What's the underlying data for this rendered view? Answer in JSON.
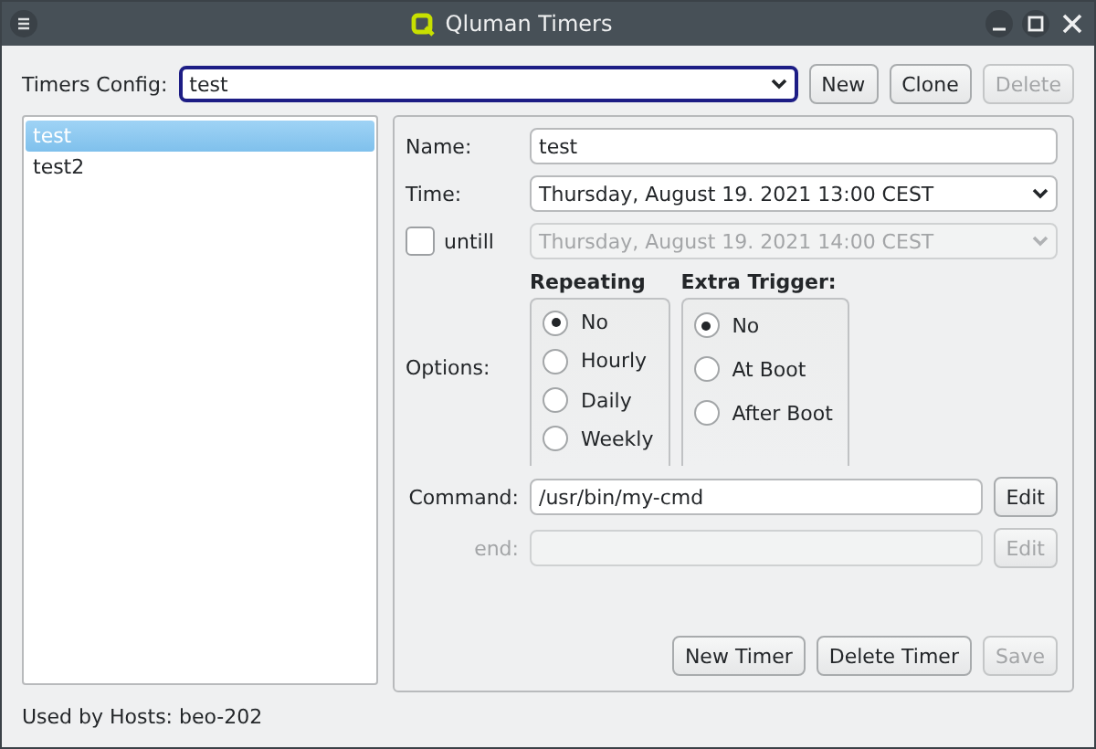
{
  "window": {
    "title": "Qluman Timers"
  },
  "config": {
    "label": "Timers Config:",
    "value": "test"
  },
  "config_buttons": [
    {
      "label": "New",
      "disabled": false
    },
    {
      "label": "Clone",
      "disabled": false
    },
    {
      "label": "Delete",
      "disabled": true
    }
  ],
  "timers": [
    {
      "label": "test",
      "selected": true
    },
    {
      "label": "test2",
      "selected": false
    }
  ],
  "form": {
    "name": {
      "label": "Name:",
      "value": "test"
    },
    "time": {
      "label": "Time:",
      "value": "Thursday, August 19. 2021 13:00 CEST"
    },
    "until": {
      "label": "untill",
      "checked": false,
      "value": "Thursday, August 19. 2021 14:00 CEST",
      "disabled": true
    },
    "options_label": "Options:",
    "groups": [
      {
        "title": "Repeating",
        "options": [
          {
            "label": "No",
            "selected": true
          },
          {
            "label": "Hourly",
            "selected": false
          },
          {
            "label": "Daily",
            "selected": false
          },
          {
            "label": "Weekly",
            "selected": false
          }
        ]
      },
      {
        "title": "Extra Trigger:",
        "options": [
          {
            "label": "No",
            "selected": true
          },
          {
            "label": "At Boot",
            "selected": false
          },
          {
            "label": "After Boot",
            "selected": false
          }
        ]
      }
    ],
    "commands": [
      {
        "label": "Command:",
        "value": "/usr/bin/my-cmd",
        "button": "Edit",
        "disabled": false
      },
      {
        "label": "end:",
        "button": "Edit",
        "disabled": true
      }
    ],
    "actions": [
      {
        "label": "New Timer",
        "disabled": false
      },
      {
        "label": "Delete Timer",
        "disabled": false
      },
      {
        "label": "Save",
        "disabled": true
      }
    ]
  },
  "status": "Used by Hosts: beo-202"
}
